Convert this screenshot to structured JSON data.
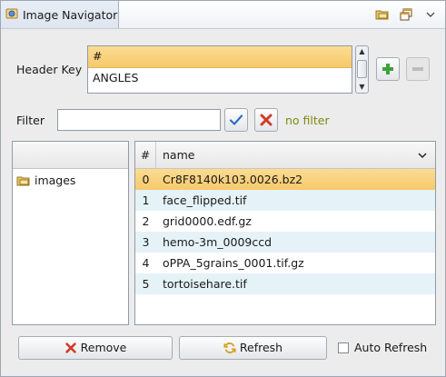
{
  "view": {
    "title": "Image Navigator",
    "icons": {
      "tab": "image-navigator-icon",
      "toolbar": [
        "open-folder-icon",
        "restore-windows-icon",
        "view-menu-chevron-icon"
      ]
    }
  },
  "header_key": {
    "label": "Header Key",
    "items": [
      "#",
      "ANGLES"
    ],
    "selected_index": 0,
    "buttons": {
      "add": "plus-icon",
      "remove": "minus-icon"
    }
  },
  "filter": {
    "label": "Filter",
    "value": "",
    "placeholder": "",
    "status": "no filter",
    "buttons": {
      "apply": "checkmark-icon",
      "clear": "red-x-icon"
    }
  },
  "tree": {
    "items": [
      {
        "label": "images",
        "icon": "folder-icon"
      }
    ]
  },
  "table": {
    "columns": [
      "#",
      "name"
    ],
    "rows": [
      {
        "num": "0",
        "name": "Cr8F8140k103.0026.bz2",
        "selected": true
      },
      {
        "num": "1",
        "name": "face_flipped.tif"
      },
      {
        "num": "2",
        "name": "grid0000.edf.gz"
      },
      {
        "num": "3",
        "name": "hemo-3m_0009ccd"
      },
      {
        "num": "4",
        "name": "oPPA_5grains_0001.tif.gz"
      },
      {
        "num": "5",
        "name": "tortoisehare.tif"
      }
    ]
  },
  "actions": {
    "remove": "Remove",
    "refresh": "Refresh",
    "auto_refresh": {
      "label": "Auto Refresh",
      "checked": false
    }
  },
  "colors": {
    "selection": "#f7c96b",
    "alt_row": "#e5f3f8",
    "no_filter_text": "#7c8a0f",
    "add_icon": "#3fa33a",
    "remove_icon": "#d23b2a",
    "apply_icon": "#2d6fc6"
  }
}
